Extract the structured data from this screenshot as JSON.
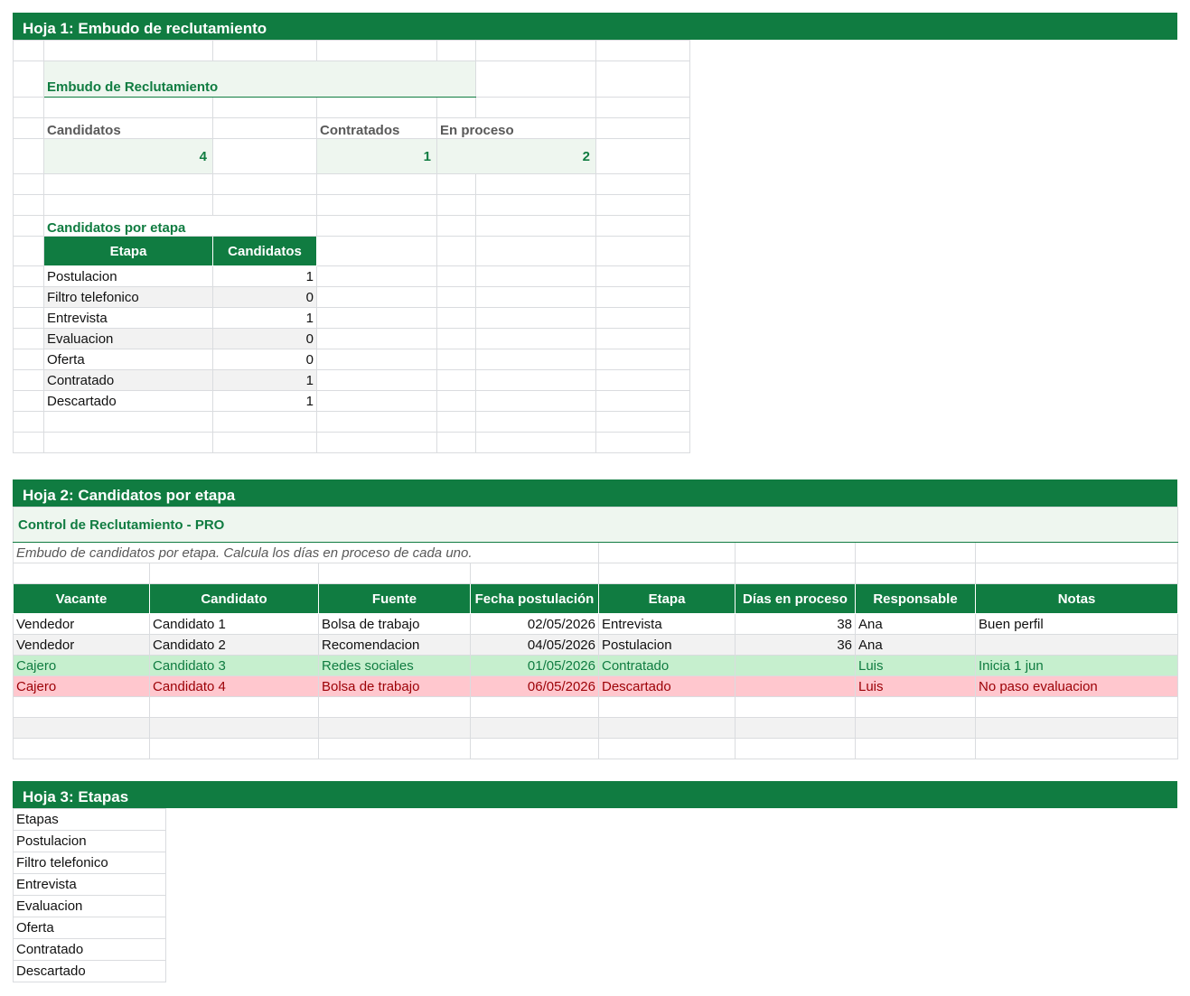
{
  "sheet1": {
    "header": "Hoja 1: Embudo de reclutamiento",
    "title": "Embudo de Reclutamiento",
    "kpis": [
      {
        "label": "Candidatos",
        "value": "4"
      },
      {
        "label": "Contratados",
        "value": "1"
      },
      {
        "label": "En proceso",
        "value": "2"
      }
    ],
    "section_label": "Candidatos por etapa",
    "table_headers": [
      "Etapa",
      "Candidatos"
    ],
    "rows": [
      {
        "stage": "Postulacion",
        "count": "1"
      },
      {
        "stage": "Filtro telefonico",
        "count": "0"
      },
      {
        "stage": "Entrevista",
        "count": "1"
      },
      {
        "stage": "Evaluacion",
        "count": "0"
      },
      {
        "stage": "Oferta",
        "count": "0"
      },
      {
        "stage": "Contratado",
        "count": "1"
      },
      {
        "stage": "Descartado",
        "count": "1"
      }
    ]
  },
  "sheet2": {
    "header": "Hoja 2: Candidatos por etapa",
    "title": "Control de Reclutamiento - PRO",
    "subtitle": "Embudo de candidatos por etapa. Calcula los días en proceso de cada uno.",
    "columns": [
      "Vacante",
      "Candidato",
      "Fuente",
      "Fecha postulación",
      "Etapa",
      "Días en proceso",
      "Responsable",
      "Notas"
    ],
    "rows": [
      [
        "Vendedor",
        "Candidato 1",
        "Bolsa de trabajo",
        "02/05/2026",
        "Entrevista",
        "38",
        "Ana",
        "Buen perfil"
      ],
      [
        "Vendedor",
        "Candidato 2",
        "Recomendacion",
        "04/05/2026",
        "Postulacion",
        "36",
        "Ana",
        ""
      ],
      [
        "Cajero",
        "Candidato 3",
        "Redes sociales",
        "01/05/2026",
        "Contratado",
        "",
        "Luis",
        "Inicia 1 jun"
      ],
      [
        "Cajero",
        "Candidato 4",
        "Bolsa de trabajo",
        "06/05/2026",
        "Descartado",
        "",
        "Luis",
        "No paso evaluacion"
      ]
    ],
    "colors": {
      "hired_fill": "#c6efce",
      "hired_text": "#107c41",
      "discarded_fill": "#ffc7ce",
      "discarded_text": "#9c0006"
    }
  },
  "sheet3": {
    "header": "Hoja 3: Etapas",
    "items": [
      "Etapas",
      "Postulacion",
      "Filtro telefonico",
      "Entrevista",
      "Evaluacion",
      "Oferta",
      "Contratado",
      "Descartado"
    ]
  },
  "theme": {
    "accent": "#107c41"
  }
}
